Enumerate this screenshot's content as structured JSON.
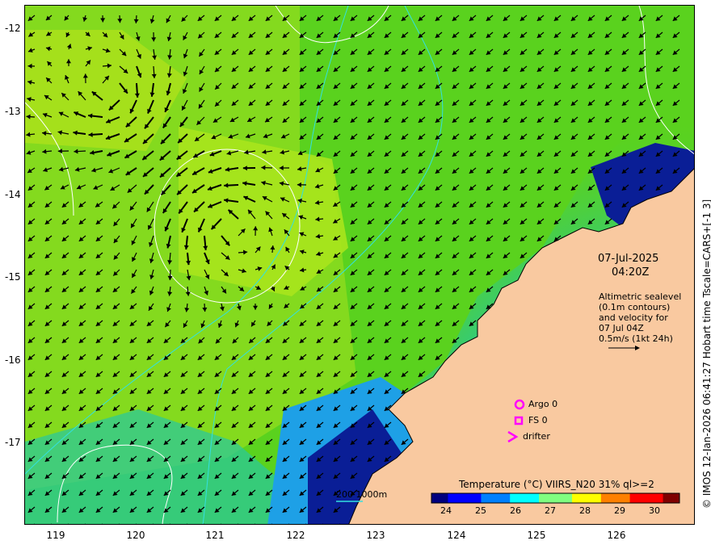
{
  "map": {
    "y_ticks": [
      "-12",
      "-13",
      "-14",
      "-15",
      "-16",
      "-17"
    ],
    "x_ticks": [
      "119",
      "120",
      "121",
      "122",
      "123",
      "124",
      "125",
      "126"
    ],
    "extent": {
      "lon": [
        118.6,
        126.9
      ],
      "lat": [
        -17.95,
        -11.65
      ]
    }
  },
  "annotations": {
    "date": "07-Jul-2025",
    "time": "04:20Z",
    "info_lines": [
      "Altimetric sealevel",
      "(0.1m contours)",
      "and velocity for",
      "07 Jul 04Z",
      "0.5m/s (1kt 24h)"
    ],
    "argo_label": "Argo 0",
    "fs_label": "FS 0",
    "drifter_label": "drifter",
    "scalebar_label": "200  1000m"
  },
  "colorbar": {
    "title": "Temperature (°C) VIIRS_N20 31% ql>=2",
    "ticks": [
      "24",
      "25",
      "26",
      "27",
      "28",
      "29",
      "30"
    ],
    "range": [
      23.6,
      30.8
    ]
  },
  "credit": "© IMOS 12-Jan-2026 06:41:27 Hobart time Tscale=CARS+[-1 3]",
  "colors": {
    "land": "#f9c9a0",
    "sea_warm": "#5ad21e",
    "sea_bright": "#a8e41c",
    "sea_cool": "#1ea0e6",
    "sea_cold": "#0a1e96",
    "contour": "#ffffff",
    "isobath": "#33e0e0",
    "markers": "#ff00ff"
  }
}
